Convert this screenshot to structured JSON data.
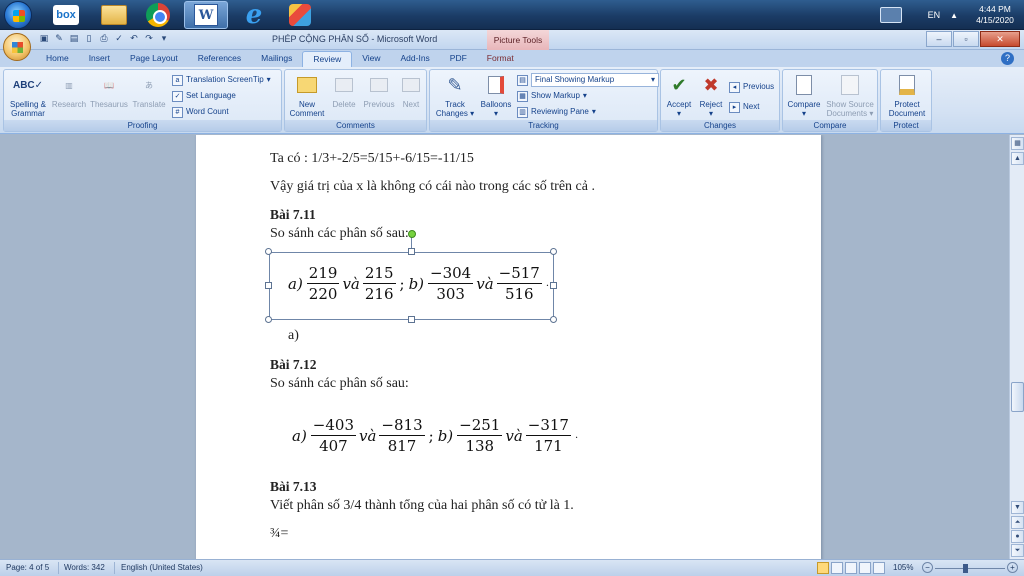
{
  "taskbar": {
    "box_label": "box",
    "language": "EN",
    "time": "4:44 PM",
    "date": "4/15/2020"
  },
  "window": {
    "title": "PHÉP CỘNG PHÂN SỐ - Microsoft Word",
    "contextual_tab_group": "Picture Tools",
    "controls": [
      "–",
      "▫",
      "✕"
    ]
  },
  "tabs": [
    "Home",
    "Insert",
    "Page Layout",
    "References",
    "Mailings",
    "Review",
    "View",
    "Add-Ins",
    "PDF",
    "Format"
  ],
  "active_tab": "Review",
  "ribbon": {
    "proofing": {
      "label": "Proofing",
      "spelling": "Spelling &",
      "spelling2": "Grammar",
      "research": "Research",
      "thesaurus": "Thesaurus",
      "translate": "Translate",
      "translation_screentip": "Translation ScreenTip",
      "set_language": "Set Language",
      "word_count": "Word Count"
    },
    "comments": {
      "label": "Comments",
      "new": "New",
      "new2": "Comment",
      "delete": "Delete",
      "previous": "Previous",
      "next": "Next"
    },
    "tracking": {
      "label": "Tracking",
      "track": "Track",
      "track2": "Changes",
      "balloons": "Balloons",
      "final_showing_markup": "Final Showing Markup",
      "show_markup": "Show Markup",
      "reviewing_pane": "Reviewing Pane"
    },
    "changes": {
      "label": "Changes",
      "accept": "Accept",
      "reject": "Reject",
      "previous": "Previous",
      "next": "Next"
    },
    "compare": {
      "label": "Compare",
      "compare": "Compare",
      "show_source": "Show Source",
      "show_source2": "Documents"
    },
    "protect": {
      "label": "Protect",
      "protect": "Protect",
      "protect2": "Document"
    }
  },
  "document": {
    "line1": "Ta có : 1/3+-2/5=5/15+-6/15=-11/15",
    "line2": "Vậy giá trị của x là không có cái nào trong các số trên cả .",
    "bai711": "Bài 7.11",
    "compare_text": "So sánh các phân số sau:",
    "eq1": {
      "a": "a)",
      "f1n": "219",
      "f1d": "220",
      "va": "và",
      "f2n": "215",
      "f2d": "216",
      "semi": ";",
      "b": "b)",
      "f3n": "−304",
      "f3d": "303",
      "f4n": "−517",
      "f4d": "516",
      "dot": "."
    },
    "list_a": "a)",
    "bai712": "Bài 7.12",
    "compare_text2": "So sánh các phân số sau:",
    "eq2": {
      "a": "a)",
      "f1n": "−403",
      "f1d": "407",
      "va": "và",
      "f2n": "−813",
      "f2d": "817",
      "semi": ";",
      "b": "b)",
      "f3n": "−251",
      "f3d": "138",
      "f4n": "−317",
      "f4d": "171",
      "dot": "."
    },
    "bai713": "Bài 7.13",
    "line_713": "Viết phân số 3/4 thành tổng của hai phân số có tử là 1.",
    "three_quarters": "¾="
  },
  "status": {
    "page": "Page: 4 of 5",
    "words": "Words: 342",
    "language": "English (United States)",
    "zoom": "105%"
  }
}
